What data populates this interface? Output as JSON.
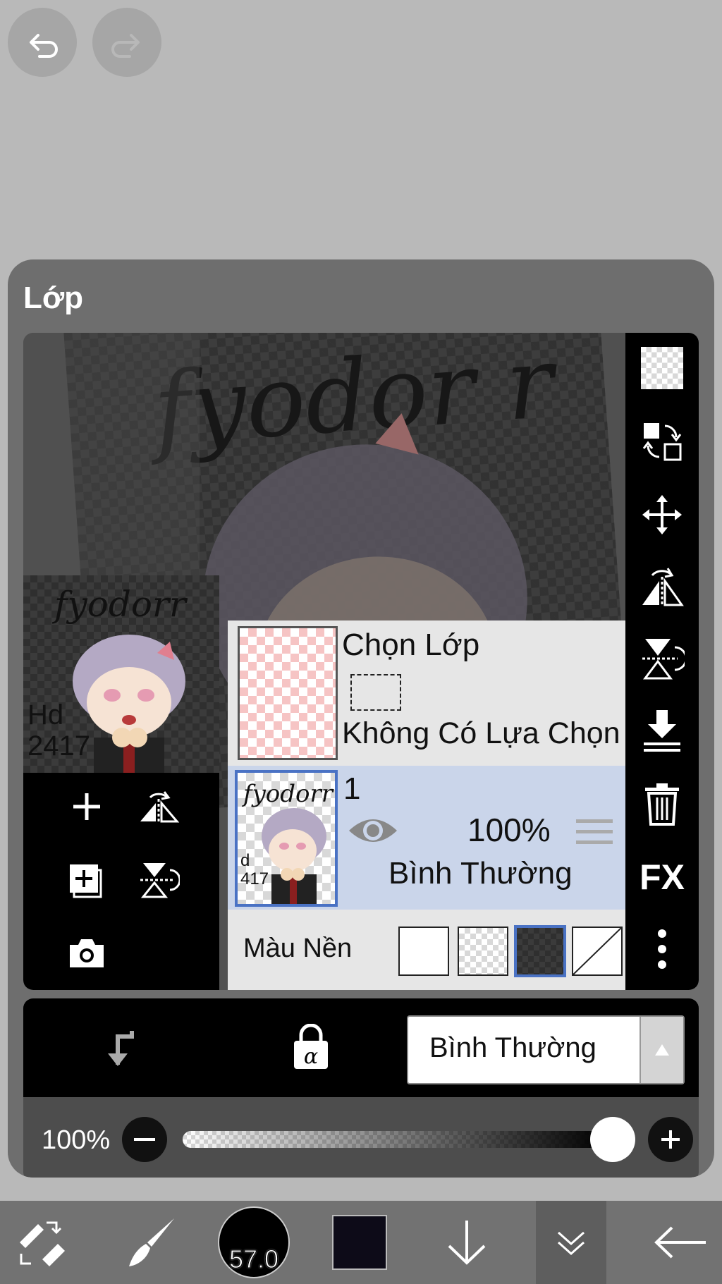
{
  "top_bar": {
    "undo_icon": "undo-icon",
    "redo_icon": "redo-icon"
  },
  "panel": {
    "title": "Lớp",
    "canvas_preview": {
      "text": "fyodor r"
    },
    "thumbnail": {
      "text": "fyodorr",
      "signature": "Hd 2417"
    },
    "selection_layer": {
      "title": "Chọn Lớp",
      "status": "Không Có Lựa Chọn"
    },
    "layer": {
      "name": "1",
      "opacity": "100%",
      "blend_mode": "Bình Thường",
      "visible": true,
      "thumb_text": "fyodorr",
      "thumb_sig": "d 417"
    },
    "background": {
      "label": "Màu Nền",
      "options": [
        "white",
        "light-checker",
        "dark-checker",
        "none"
      ],
      "selected": "dark-checker"
    },
    "right_tools": [
      "checker-icon",
      "swap-layers-icon",
      "move-icon",
      "flip-horizontal-icon",
      "flip-vertical-icon",
      "merge-down-icon",
      "trash-icon",
      "fx-icon",
      "more-icon"
    ],
    "fx_label": "FX",
    "left_tools": [
      "add-layer-icon",
      "flip-layer-icon",
      "duplicate-layer-icon",
      "rotate-layer-icon",
      "camera-icon"
    ],
    "blend_select": {
      "value": "Bình Thường"
    },
    "opacity": {
      "label": "100%",
      "value": 1.0
    }
  },
  "bottom_toolbar": {
    "brush_size": "57.0",
    "color": "#0d0b18",
    "items": [
      "tools-icon",
      "brush-icon",
      "brush-size",
      "color-swatch",
      "arrow-down-icon",
      "chevron-double-down-icon",
      "back-arrow-icon"
    ]
  }
}
